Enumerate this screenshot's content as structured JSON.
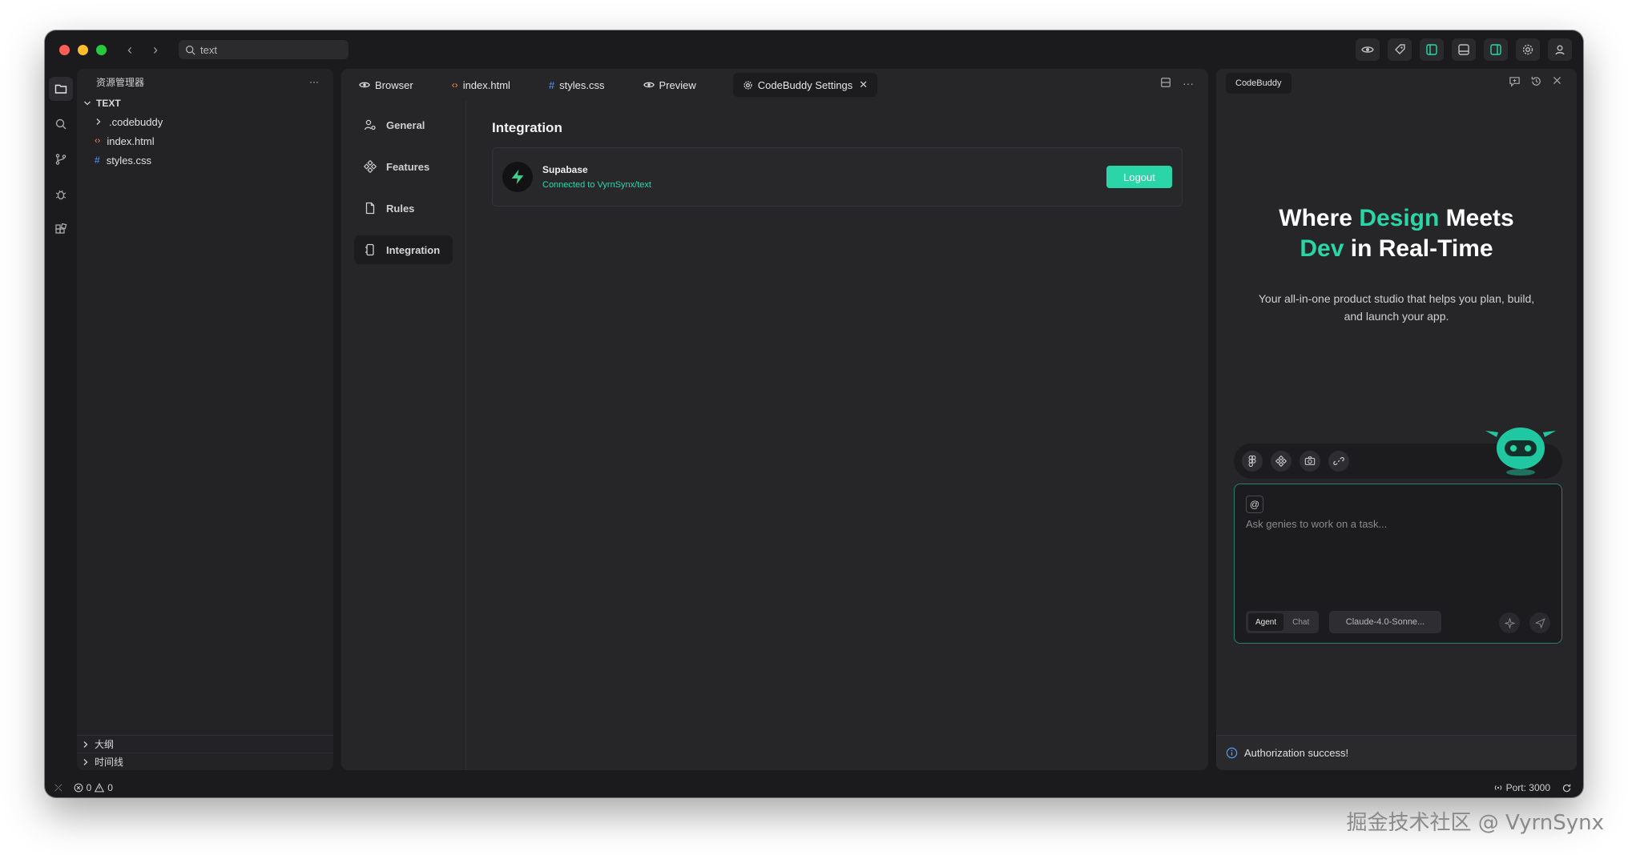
{
  "titlebar": {
    "search_text": "text"
  },
  "explorer": {
    "title": "资源管理器",
    "more": "···",
    "root": "TEXT",
    "items": [
      {
        "name": ".codebuddy",
        "kind": "folder"
      },
      {
        "name": "index.html",
        "kind": "html"
      },
      {
        "name": "styles.css",
        "kind": "css"
      }
    ],
    "footer": [
      "大纲",
      "时间线"
    ]
  },
  "editor": {
    "tabs": [
      {
        "label": "Browser"
      },
      {
        "label": "index.html"
      },
      {
        "label": "styles.css"
      },
      {
        "label": "Preview"
      },
      {
        "label": "CodeBuddy Settings"
      }
    ],
    "more": "···"
  },
  "settings": {
    "nav": [
      "General",
      "Features",
      "Rules",
      "Integration"
    ],
    "active_nav": "Integration",
    "section_title": "Integration",
    "integration": {
      "name": "Supabase",
      "status": "Connected to VyrnSynx/text",
      "button": "Logout"
    }
  },
  "assistant": {
    "tab": "CodeBuddy",
    "hero_title_part1": "Where ",
    "hero_title_hl1": "Design",
    "hero_title_part2": " Meets",
    "hero_title_hl2": "Dev",
    "hero_title_part3": " in Real-Time",
    "hero_subtitle": "Your all-in-one product studio that helps you plan, build, and launch your app.",
    "composer": {
      "at": "@",
      "placeholder": "Ask genies to work on a task...",
      "modes": [
        "Agent",
        "Chat"
      ],
      "active_mode": "Agent",
      "model": "Claude-4.0-Sonne..."
    },
    "notice": "Authorization success!"
  },
  "statusbar": {
    "errors": "0",
    "warnings": "0",
    "port": "Port: 3000"
  },
  "watermark": "掘金技术社区 @ VyrnSynx",
  "colors": {
    "accent": "#2ad6a8",
    "window_bg": "#1b1b1d",
    "panel_bg": "#262629"
  }
}
